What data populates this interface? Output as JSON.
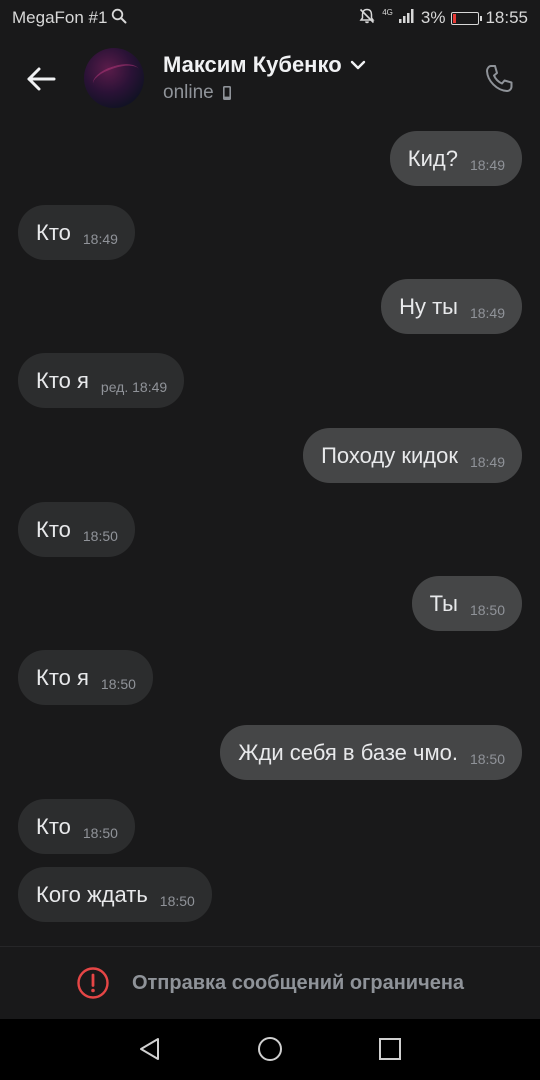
{
  "status_bar": {
    "carrier": "MegaFon #1",
    "network": "4G",
    "battery_percent": "3%",
    "battery_level": 0.03,
    "time": "18:55"
  },
  "header": {
    "contact_name": "Максим Кубенко",
    "status": "online",
    "icons": {
      "back": "arrow-left-icon",
      "name_dropdown": "chevron-down-icon",
      "device": "mobile-phone-icon",
      "call": "phone-icon"
    }
  },
  "messages": [
    {
      "direction": "out",
      "text": "Кид?",
      "time": "18:49"
    },
    {
      "direction": "in",
      "text": "Кто",
      "time": "18:49"
    },
    {
      "direction": "out",
      "text": "Ну ты",
      "time": "18:49"
    },
    {
      "direction": "in",
      "text": "Кто я",
      "time": "ред. 18:49"
    },
    {
      "direction": "out",
      "text": "Походу кидок",
      "time": "18:49"
    },
    {
      "direction": "in",
      "text": "Кто",
      "time": "18:50"
    },
    {
      "direction": "out",
      "text": "Ты",
      "time": "18:50"
    },
    {
      "direction": "in",
      "text": "Кто я",
      "time": "18:50"
    },
    {
      "direction": "out",
      "text": "Жди себя в базе чмо.",
      "time": "18:50"
    },
    {
      "direction": "in",
      "text": "Кто",
      "time": "18:50"
    },
    {
      "direction": "in",
      "text": "Кого ждать",
      "time": "18:50"
    }
  ],
  "restricted": {
    "text": "Отправка сообщений ограничена",
    "icon": "alert-circle-icon",
    "accent": "#e64646"
  },
  "nav_bar": {
    "icons": [
      "back-triangle-icon",
      "home-circle-icon",
      "recents-square-icon"
    ]
  },
  "colors": {
    "background": "#19191a",
    "bubble_out": "#454647",
    "bubble_in": "#2c2d2e"
  }
}
